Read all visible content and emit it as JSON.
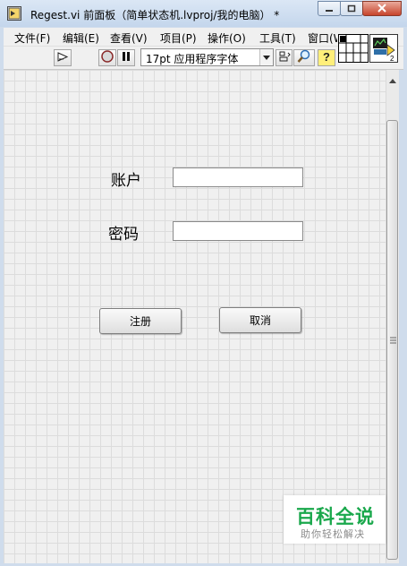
{
  "window": {
    "title": "Regest.vi 前面板（简单状态机.lvproj/我的电脑） *"
  },
  "menubar": {
    "items": [
      "文件(F)",
      "编辑(E)",
      "查看(V)",
      "项目(P)",
      "操作(O)",
      "工具(T)",
      "窗口(W)"
    ]
  },
  "toolbar": {
    "font_select": "17pt 应用程序字体",
    "connector_terminal_number": "2"
  },
  "form": {
    "account_label": "账户",
    "account_value": "",
    "password_label": "密码",
    "password_value": "",
    "register_button": "注册",
    "cancel_button": "取消"
  },
  "watermark": {
    "brand": "百科全说",
    "tagline": "助你轻松解决"
  },
  "colors": {
    "accent_green": "#1aa84c",
    "close_red": "#c7452c",
    "panel_bg": "#f0f0f0"
  },
  "icons": [
    "labview-vi-icon",
    "minimize-icon",
    "maximize-icon",
    "close-icon",
    "run-arrow-icon",
    "abort-icon",
    "pause-icon",
    "font-dropdown-icon",
    "align-icon",
    "search-icon",
    "help-icon",
    "connector-pane-icon",
    "vi-icon"
  ]
}
